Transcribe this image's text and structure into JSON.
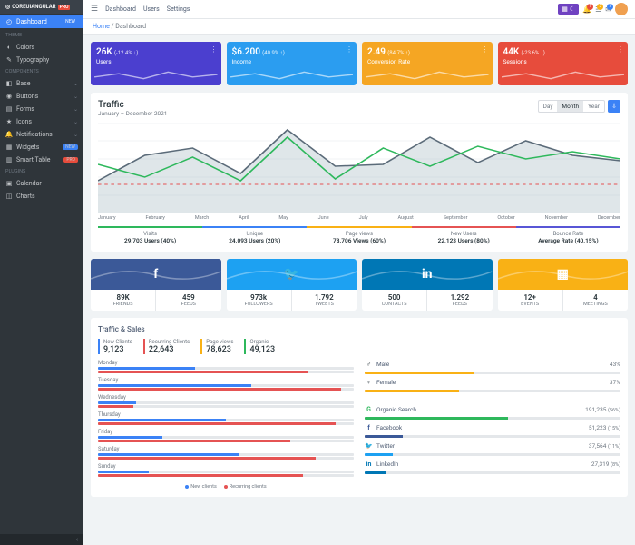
{
  "logo": {
    "text": "COREUIANGULAR",
    "badge": "PRO"
  },
  "topnav": [
    "Dashboard",
    "Users",
    "Settings"
  ],
  "topbar": {
    "notif1": "1",
    "notif2": "5",
    "notif3": "7"
  },
  "breadcrumb": {
    "home": "Home",
    "current": "Dashboard"
  },
  "sidebar": {
    "dashboard": {
      "label": "Dashboard",
      "badge": "NEW"
    },
    "theme_header": "THEME",
    "theme": [
      {
        "label": "Colors",
        "ico": "◐"
      },
      {
        "label": "Typography",
        "ico": "✎"
      }
    ],
    "components_header": "COMPONENTS",
    "components": [
      {
        "label": "Base",
        "ico": "◧"
      },
      {
        "label": "Buttons",
        "ico": "◉"
      },
      {
        "label": "Forms",
        "ico": "▤"
      },
      {
        "label": "Icons",
        "ico": "★"
      },
      {
        "label": "Notifications",
        "ico": "🔔"
      },
      {
        "label": "Widgets",
        "ico": "▦",
        "badge": "NEW",
        "badgeClass": "new"
      },
      {
        "label": "Smart Table",
        "ico": "▥",
        "badge": "PRO",
        "badgeClass": "pro"
      }
    ],
    "plugins_header": "PLUGINS",
    "plugins": [
      {
        "label": "Calendar",
        "ico": "▣"
      },
      {
        "label": "Charts",
        "ico": "◫"
      }
    ]
  },
  "cards": [
    {
      "big": "26K",
      "sub": "(-12.4% ↓)",
      "label": "Users",
      "cls": "c-blue"
    },
    {
      "big": "$6.200",
      "sub": "(40.9% ↑)",
      "label": "Income",
      "cls": "c-cyan"
    },
    {
      "big": "2.49",
      "sub": "(84.7% ↑)",
      "label": "Conversion Rate",
      "cls": "c-orange"
    },
    {
      "big": "44K",
      "sub": "(-23.6% ↓)",
      "label": "Sessions",
      "cls": "c-red"
    }
  ],
  "traffic": {
    "title": "Traffic",
    "period": "January – December 2021",
    "range": [
      "Day",
      "Month",
      "Year"
    ],
    "active_range": "Month",
    "months": [
      "January",
      "February",
      "March",
      "April",
      "May",
      "June",
      "July",
      "August",
      "September",
      "October",
      "November",
      "December"
    ],
    "stats": [
      {
        "l": "Visits",
        "v": "29.703 Users (40%)",
        "color": "#2eb85c"
      },
      {
        "l": "Unique",
        "v": "24.093 Users (20%)",
        "color": "#3b82f6"
      },
      {
        "l": "Page views",
        "v": "78.706 Views (60%)",
        "color": "#f9b115"
      },
      {
        "l": "New Users",
        "v": "22.123 Users (80%)",
        "color": "#e55353"
      },
      {
        "l": "Bounce Rate",
        "v": "Average Rate (40.15%)",
        "color": "#5856d6"
      }
    ]
  },
  "social": [
    {
      "brand": "facebook",
      "bg": "#3b5998",
      "ico": "f",
      "a": {
        "n": "89K",
        "l": "FRIENDS"
      },
      "b": {
        "n": "459",
        "l": "FEEDS"
      }
    },
    {
      "brand": "twitter",
      "bg": "#1da1f2",
      "ico": "🐦",
      "a": {
        "n": "973k",
        "l": "FOLLOWERS"
      },
      "b": {
        "n": "1.792",
        "l": "TWEETS"
      }
    },
    {
      "brand": "linkedin",
      "bg": "#0077b5",
      "ico": "in",
      "a": {
        "n": "500",
        "l": "CONTACTS"
      },
      "b": {
        "n": "1.292",
        "l": "FEEDS"
      }
    },
    {
      "brand": "calendar",
      "bg": "#f9b115",
      "ico": "▦",
      "a": {
        "n": "12+",
        "l": "EVENTS"
      },
      "b": {
        "n": "4",
        "l": "MEETINGS"
      }
    }
  ],
  "ts": {
    "title": "Traffic & Sales",
    "metrics": [
      {
        "l": "New Clients",
        "v": "9,123",
        "color": "#3b82f6"
      },
      {
        "l": "Recurring Clients",
        "v": "22,643",
        "color": "#e55353"
      },
      {
        "l": "Page views",
        "v": "78,623",
        "color": "#f9b115"
      },
      {
        "l": "Organic",
        "v": "49,123",
        "color": "#2eb85c"
      }
    ],
    "days": [
      {
        "d": "Monday",
        "a": 38,
        "b": 82
      },
      {
        "d": "Tuesday",
        "a": 60,
        "b": 95
      },
      {
        "d": "Wednesday",
        "a": 15,
        "b": 14
      },
      {
        "d": "Thursday",
        "a": 50,
        "b": 93
      },
      {
        "d": "Friday",
        "a": 25,
        "b": 75
      },
      {
        "d": "Saturday",
        "a": 55,
        "b": 85
      },
      {
        "d": "Sunday",
        "a": 20,
        "b": 80
      }
    ],
    "legend": {
      "a": "New clients",
      "b": "Recurring clients"
    },
    "gender": [
      {
        "l": "Male",
        "v": "43%",
        "ico": "♂"
      },
      {
        "l": "Female",
        "v": "37%",
        "ico": "♀"
      }
    ],
    "sources": [
      {
        "l": "Organic Search",
        "v": "191,235",
        "pct": "(56%)",
        "ico": "G",
        "color": "#2eb85c"
      },
      {
        "l": "Facebook",
        "v": "51,223",
        "pct": "(15%)",
        "ico": "f",
        "color": "#3b5998"
      },
      {
        "l": "Twitter",
        "v": "37,564",
        "pct": "(11%)",
        "ico": "🐦",
        "color": "#1da1f2"
      },
      {
        "l": "LinkedIn",
        "v": "27,319",
        "pct": "(8%)",
        "ico": "in",
        "color": "#0077b5"
      }
    ]
  },
  "chart_data": {
    "type": "line",
    "x": [
      "January",
      "February",
      "March",
      "April",
      "May",
      "June",
      "July",
      "August",
      "September",
      "October",
      "November",
      "December"
    ],
    "series": [
      {
        "name": "area",
        "values": [
          90,
          160,
          180,
          110,
          230,
          130,
          135,
          210,
          140,
          200,
          160,
          145
        ],
        "color": "#a4b7c1"
      },
      {
        "name": "line",
        "values": [
          135,
          100,
          155,
          90,
          210,
          95,
          180,
          130,
          185,
          150,
          170,
          150
        ],
        "color": "#2eb85c"
      },
      {
        "name": "dashed",
        "values": [
          80,
          80,
          80,
          80,
          80,
          80,
          80,
          80,
          80,
          80,
          80,
          80
        ],
        "color": "#e55353"
      }
    ],
    "ylim": [
      0,
      250
    ],
    "yticks": [
      0,
      50,
      100,
      150,
      200,
      250
    ]
  }
}
